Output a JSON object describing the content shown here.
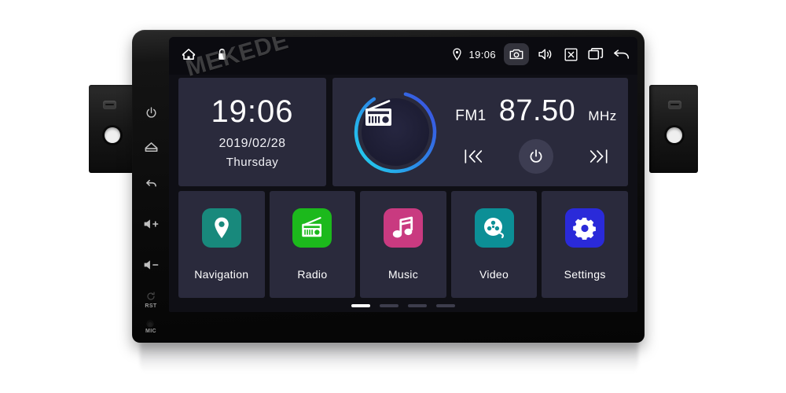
{
  "device": {
    "brand_watermark": "MEKEDE",
    "hardware_buttons": [
      {
        "name": "power",
        "icon": "power-icon",
        "label": ""
      },
      {
        "name": "home",
        "icon": "home-icon",
        "label": ""
      },
      {
        "name": "back",
        "icon": "back-arrow-icon",
        "label": ""
      },
      {
        "name": "volume-up",
        "icon": "volume-up-icon",
        "label": ""
      },
      {
        "name": "volume-down",
        "icon": "volume-down-icon",
        "label": ""
      },
      {
        "name": "reset",
        "icon": "reset-icon",
        "label": "RST"
      },
      {
        "name": "microphone",
        "icon": "mic-icon",
        "label": "MIC"
      }
    ]
  },
  "statusbar": {
    "home_icon": "home-icon",
    "lock_icon": "lock-icon",
    "location_icon": "location-pin-icon",
    "time": "19:06",
    "camera_icon": "camera-icon",
    "volume_icon": "volume-icon",
    "close_icon": "close-box-icon",
    "recents_icon": "recent-apps-icon",
    "back_icon": "back-arrow-icon"
  },
  "clock_widget": {
    "time": "19:06",
    "date": "2019/02/28",
    "weekday": "Thursday"
  },
  "radio_widget": {
    "dial_icon": "radio-icon",
    "band": "FM1",
    "frequency": "87.50",
    "unit": "MHz",
    "prev_icon": "skip-previous-icon",
    "power_icon": "power-icon",
    "next_icon": "skip-next-icon",
    "ring_color_start": "#22d3ee",
    "ring_color_end": "#3b4fe0"
  },
  "tiles": [
    {
      "label": "Navigation",
      "icon": "location-pin-icon",
      "color": "#18897c"
    },
    {
      "label": "Radio",
      "icon": "radio-icon",
      "color": "#1cb91c"
    },
    {
      "label": "Music",
      "icon": "music-note-icon",
      "color": "#c93a80"
    },
    {
      "label": "Video",
      "icon": "film-reel-icon",
      "color": "#0c8f96"
    },
    {
      "label": "Settings",
      "icon": "gear-icon",
      "color": "#2a2ad9"
    }
  ],
  "pager": {
    "total": 4,
    "active_index": 0
  },
  "colors": {
    "screen_background": "#0f0f15",
    "widget_background": "#2a2a3c",
    "statusbar_background": "#0b0b10",
    "text_primary": "#ffffff"
  }
}
